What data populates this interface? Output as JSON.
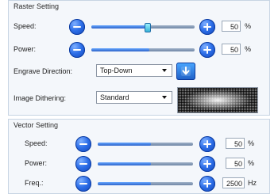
{
  "raster": {
    "title": "Raster Setting",
    "speed": {
      "label": "Speed:",
      "value": "50",
      "unit": "%",
      "fill_pct": 50
    },
    "power": {
      "label": "Power:",
      "value": "50",
      "unit": "%",
      "fill_pct": 50
    },
    "engrave_direction": {
      "label": "Engrave Direction:",
      "selected": "Top-Down"
    },
    "dithering": {
      "label": "Image Dithering:",
      "selected": "Standard"
    }
  },
  "vector": {
    "title": "Vector Setting",
    "speed": {
      "label": "Speed:",
      "value": "50",
      "unit": "%",
      "fill_pct": 50
    },
    "power": {
      "label": "Power:",
      "value": "50",
      "unit": "%",
      "fill_pct": 50
    },
    "freq": {
      "label": "Freq.:",
      "value": "2500",
      "unit": "Hz",
      "fill_pct": 50
    }
  },
  "colors": {
    "accent_blue": "#2e6fe8",
    "panel_bg": "#f4f7fb",
    "panel_border": "#c7d4e3"
  },
  "icons": {
    "decrement": "minus-icon",
    "increment": "plus-icon",
    "direction": "arrow-down-icon",
    "preview": "dither-preview"
  }
}
